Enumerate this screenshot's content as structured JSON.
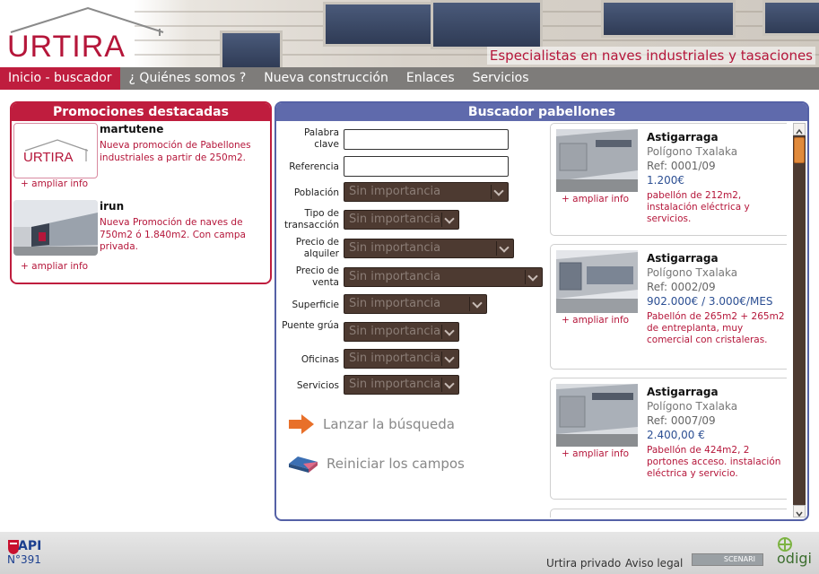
{
  "header": {
    "logo_text": "URTIRA",
    "tagline": "Especialistas en naves industriales y tasaciones"
  },
  "nav": {
    "items": [
      {
        "label": "Inicio - buscador",
        "active": true
      },
      {
        "label": "¿ Quiénes somos ?",
        "active": false
      },
      {
        "label": "Nueva construcción",
        "active": false
      },
      {
        "label": "Enlaces",
        "active": false
      },
      {
        "label": "Servicios",
        "active": false
      }
    ]
  },
  "promotions": {
    "title": "Promociones destacadas",
    "items": [
      {
        "name": "martutene",
        "description": "Nueva promoción de Pabellones industriales a partir de 250m2.",
        "more": "+ ampliar info"
      },
      {
        "name": "irun",
        "description": "Nueva Promoción de naves de 750m2 ó 1.840m2. Con campa privada.",
        "more": "+ ampliar info"
      }
    ]
  },
  "search": {
    "title": "Buscador pabellones",
    "fields": {
      "keyword_label": "Palabra clave",
      "reference_label": "Referencia",
      "population_label": "Población",
      "transaction_label": "Tipo de transacción",
      "rent_label": "Precio de alquiler",
      "sale_label": "Precio de venta",
      "surface_label": "Superficie",
      "crane_label": "Puente grúa",
      "offices_label": "Oficinas",
      "services_label": "Servicios"
    },
    "default_option": "Sin importancia",
    "launch_label": "Lanzar la búsqueda",
    "reset_label": "Reiniciar los campos"
  },
  "results": [
    {
      "town": "Astigarraga",
      "area": "Polígono Txalaka",
      "ref": "Ref: 0001/09",
      "price": "1.200€",
      "description": "pabellón de 212m2, instalación eléctrica y servicios.",
      "more": "+ ampliar info"
    },
    {
      "town": "Astigarraga",
      "area": "Polígono Txalaka",
      "ref": "Ref: 0002/09",
      "price": "902.000€ / 3.000€/MES",
      "description": "Pabellón de 265m2 + 265m2 de entreplanta, muy comercial con cristaleras.",
      "more": "+ ampliar info"
    },
    {
      "town": "Astigarraga",
      "area": "Polígono Txalaka",
      "ref": "Ref: 0007/09",
      "price": "2.400,00 €",
      "description": "Pabellón de 424m2, 2 portones acceso. instalación eléctrica y servicio.",
      "more": "+ ampliar info"
    }
  ],
  "footer": {
    "api_text": "API",
    "api_number": "N°391",
    "private_link": "Urtira privado",
    "legal_link": "Aviso legal",
    "scenari_badge": "SCENARI",
    "odigi_logo": "odigi"
  },
  "colors": {
    "brand_red": "#bf1d3e",
    "search_blue": "#5f6aac",
    "select_brown": "#4d3a31",
    "nav_gray": "#7e7c7a"
  },
  "icons": {
    "launch": "arrow-right-icon",
    "reset": "eraser-icon"
  }
}
